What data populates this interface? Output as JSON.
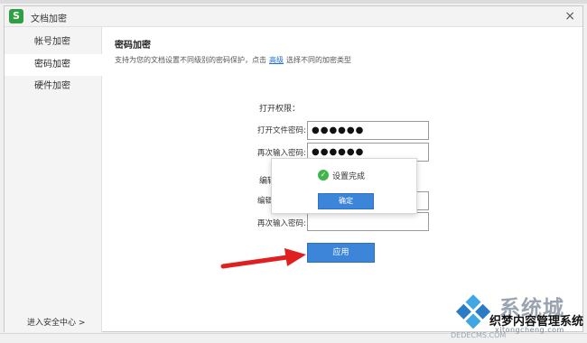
{
  "window": {
    "title": "文档加密",
    "close_label": "×",
    "logo_text": "S"
  },
  "sidebar": {
    "items": [
      {
        "label": "帐号加密",
        "active": false
      },
      {
        "label": "密码加密",
        "active": true
      },
      {
        "label": "硬件加密",
        "active": false
      }
    ],
    "security_center": "进入安全中心 >"
  },
  "main": {
    "heading": "密码加密",
    "description_prefix": "支持为您的文档设置不同级别的密码保护，点击",
    "description_link": "高级",
    "description_suffix": "选择不同的加密类型",
    "open_section": "打开权限：",
    "edit_section": "编辑",
    "fields": [
      {
        "label": "打开文件密码:",
        "value": "●●●●●●"
      },
      {
        "label": "再次输入密码:",
        "value": "●●●●●●"
      },
      {
        "label": "编辑",
        "value": ""
      },
      {
        "label": "再次输入密码:",
        "value": ""
      }
    ],
    "apply_button": "应用"
  },
  "toast": {
    "message": "设置完成",
    "confirm": "确定",
    "icon": "check-icon"
  },
  "watermark": {
    "brand": "系统城",
    "subtitle": "织梦内容管理系统",
    "domain": "xitongcheng.com",
    "url": "DEDECMS.COM"
  },
  "colors": {
    "accent": "#3d85d8",
    "success": "#3fb64a",
    "arrow": "#e02020"
  }
}
